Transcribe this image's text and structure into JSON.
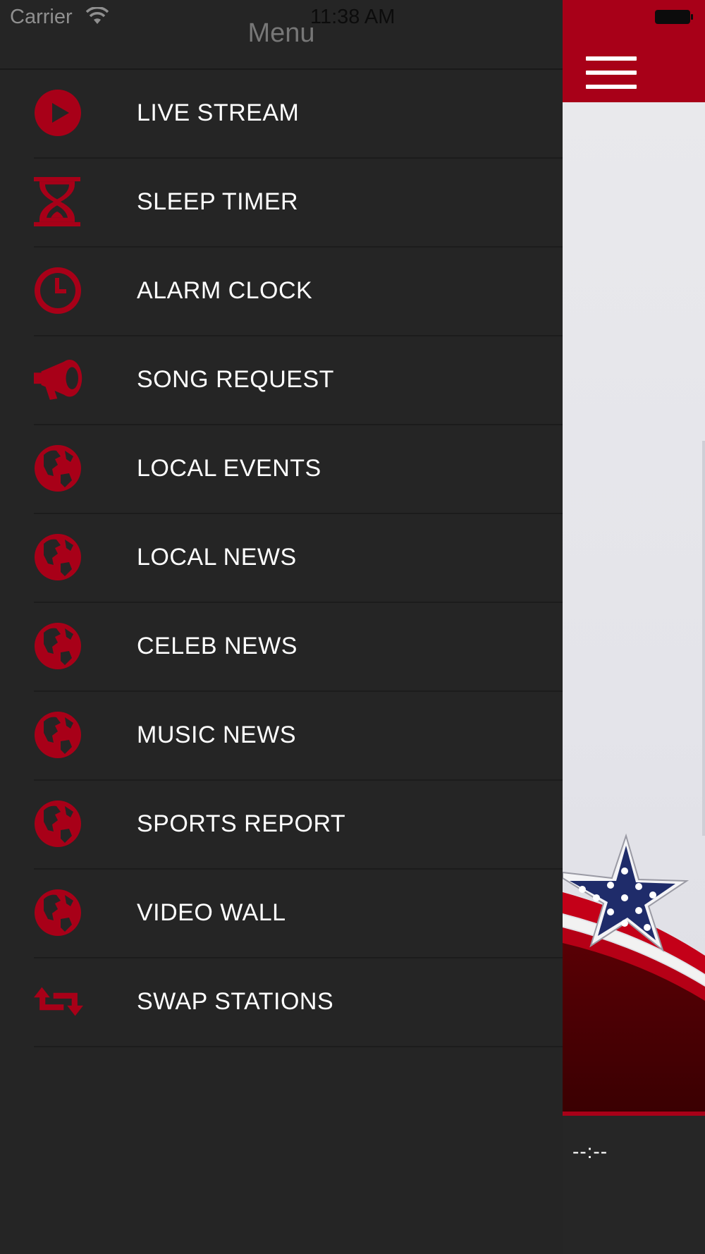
{
  "status_bar": {
    "carrier": "Carrier",
    "time": "11:38 AM"
  },
  "drawer": {
    "title": "Menu",
    "items": [
      {
        "label": "LIVE STREAM",
        "icon": "play-icon"
      },
      {
        "label": "SLEEP TIMER",
        "icon": "hourglass-icon"
      },
      {
        "label": "ALARM CLOCK",
        "icon": "clock-icon"
      },
      {
        "label": "SONG REQUEST",
        "icon": "megaphone-icon"
      },
      {
        "label": "LOCAL EVENTS",
        "icon": "globe-icon"
      },
      {
        "label": "LOCAL NEWS",
        "icon": "globe-icon"
      },
      {
        "label": "CELEB NEWS",
        "icon": "globe-icon"
      },
      {
        "label": "MUSIC NEWS",
        "icon": "globe-icon"
      },
      {
        "label": "SPORTS REPORT",
        "icon": "globe-icon"
      },
      {
        "label": "VIDEO WALL",
        "icon": "globe-icon"
      },
      {
        "label": "SWAP STATIONS",
        "icon": "swap-icon"
      }
    ]
  },
  "player": {
    "time": "--:--"
  },
  "colors": {
    "accent": "#a80018",
    "drawer_bg": "#252525",
    "text": "#ffffff"
  }
}
